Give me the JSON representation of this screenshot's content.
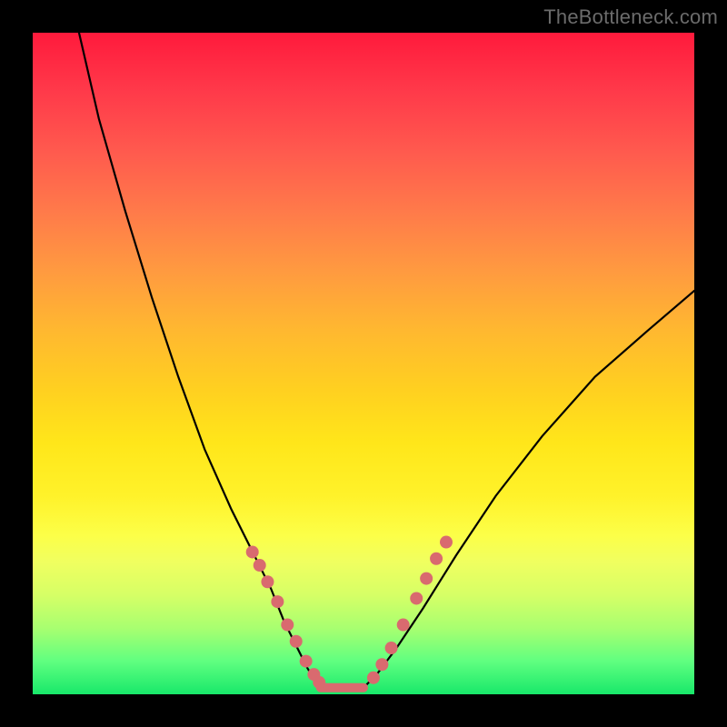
{
  "watermark": "TheBottleneck.com",
  "colors": {
    "dot": "#d96a6f",
    "curve": "#000000",
    "frame": "#000000"
  },
  "chart_data": {
    "type": "line",
    "title": "",
    "xlabel": "",
    "ylabel": "",
    "xlim": [
      0,
      100
    ],
    "ylim": [
      0,
      100
    ],
    "grid": false,
    "legend": false,
    "series": [
      {
        "name": "left-curve",
        "x": [
          7,
          10,
          14,
          18,
          22,
          26,
          30,
          33,
          36,
          38,
          40,
          41.5,
          42.7,
          43.5
        ],
        "values": [
          100,
          87,
          73,
          60,
          48,
          37,
          28,
          22,
          16,
          11,
          7,
          4,
          2,
          1
        ]
      },
      {
        "name": "right-curve",
        "x": [
          50,
          52,
          55,
          59,
          64,
          70,
          77,
          85,
          93,
          100
        ],
        "values": [
          1,
          3,
          7,
          13,
          21,
          30,
          39,
          48,
          55,
          61
        ]
      },
      {
        "name": "flat-bottom",
        "x": [
          43.5,
          50
        ],
        "values": [
          1,
          1
        ]
      }
    ],
    "markers": {
      "left_dots_x": [
        33.2,
        34.3,
        35.5,
        37.0,
        38.5,
        39.8,
        41.3,
        42.5,
        43.3
      ],
      "left_dots_y": [
        21.5,
        19.5,
        17.0,
        14.0,
        10.5,
        8.0,
        5.0,
        3.0,
        1.8
      ],
      "right_dots_x": [
        51.5,
        52.8,
        54.2,
        56.0,
        58.0,
        59.5,
        61.0,
        62.5
      ],
      "right_dots_y": [
        2.5,
        4.5,
        7.0,
        10.5,
        14.5,
        17.5,
        20.5,
        23.0
      ]
    }
  }
}
